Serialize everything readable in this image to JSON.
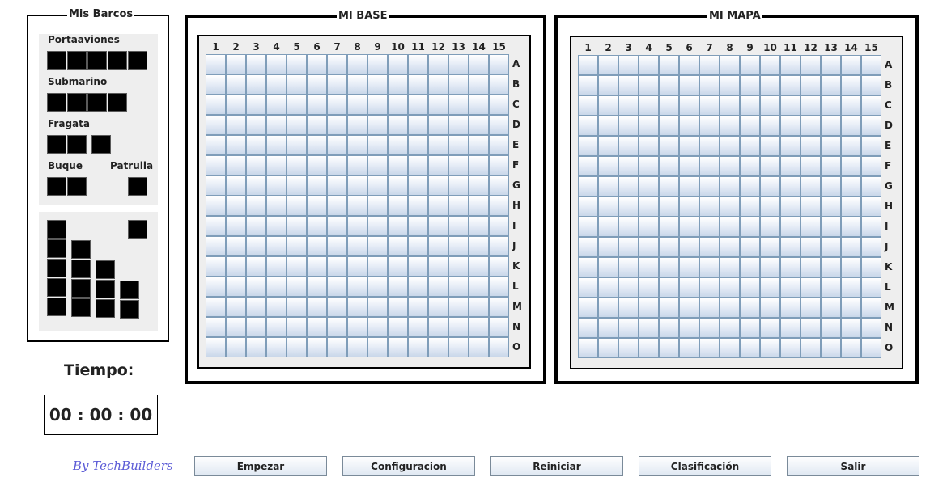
{
  "barcos_panel": {
    "title": "Mis Barcos",
    "ships": [
      {
        "label": "Portaaviones"
      },
      {
        "label": "Submarino"
      },
      {
        "label": "Fragata"
      },
      {
        "label": "Buque"
      },
      {
        "label": "Patrulla"
      }
    ]
  },
  "tiempo": {
    "label": "Tiempo:",
    "value": "00 : 00 : 00"
  },
  "credit": "By TechBuilders",
  "boards": [
    {
      "title": "MI BASE"
    },
    {
      "title": "MI MAPA"
    }
  ],
  "columns": [
    "1",
    "2",
    "3",
    "4",
    "5",
    "6",
    "7",
    "8",
    "9",
    "10",
    "11",
    "12",
    "13",
    "14",
    "15"
  ],
  "rows": [
    "A",
    "B",
    "C",
    "D",
    "E",
    "F",
    "G",
    "H",
    "I",
    "J",
    "K",
    "L",
    "M",
    "N",
    "O"
  ],
  "buttons": {
    "empezar": "Empezar",
    "configuracion": "Configuracion",
    "reiniciar": "Reiniciar",
    "clasificacion": "Clasificación",
    "salir": "Salir"
  }
}
